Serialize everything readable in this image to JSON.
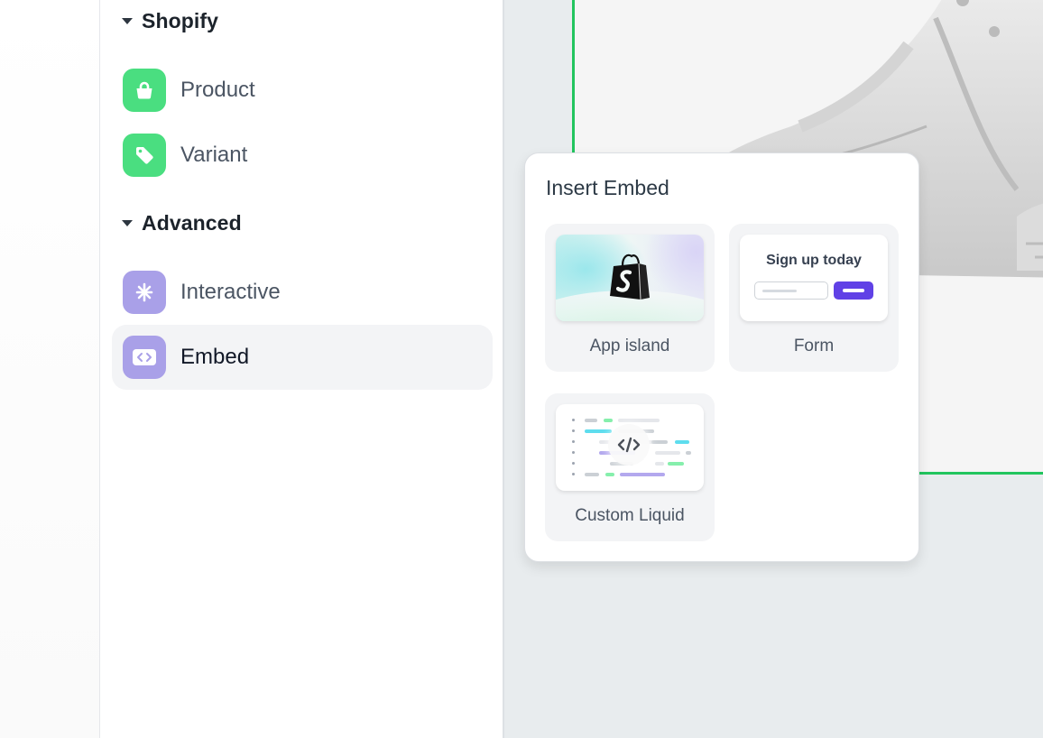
{
  "sidebar": {
    "sections": [
      {
        "title": "Shopify",
        "expanded": true,
        "items": [
          {
            "label": "Product",
            "icon": "shopping-bag-icon",
            "color": "#4ade80"
          },
          {
            "label": "Variant",
            "icon": "tag-icon",
            "color": "#4ade80"
          }
        ]
      },
      {
        "title": "Advanced",
        "expanded": true,
        "items": [
          {
            "label": "Interactive",
            "icon": "asterisk-icon",
            "color": "#a9a0e8"
          },
          {
            "label": "Embed",
            "icon": "code-icon",
            "color": "#a9a0e8",
            "selected": true
          }
        ]
      }
    ]
  },
  "popover": {
    "title": "Insert Embed",
    "tiles": [
      {
        "label": "App island",
        "preview": "shopify-bag-preview"
      },
      {
        "label": "Form",
        "preview": "form-preview",
        "form_heading": "Sign up today",
        "button_color": "#6041e6"
      },
      {
        "label": "Custom Liquid",
        "preview": "code-preview"
      }
    ]
  },
  "canvas": {
    "selection_color": "#22c55e",
    "image": "white-sneaker-photo"
  }
}
